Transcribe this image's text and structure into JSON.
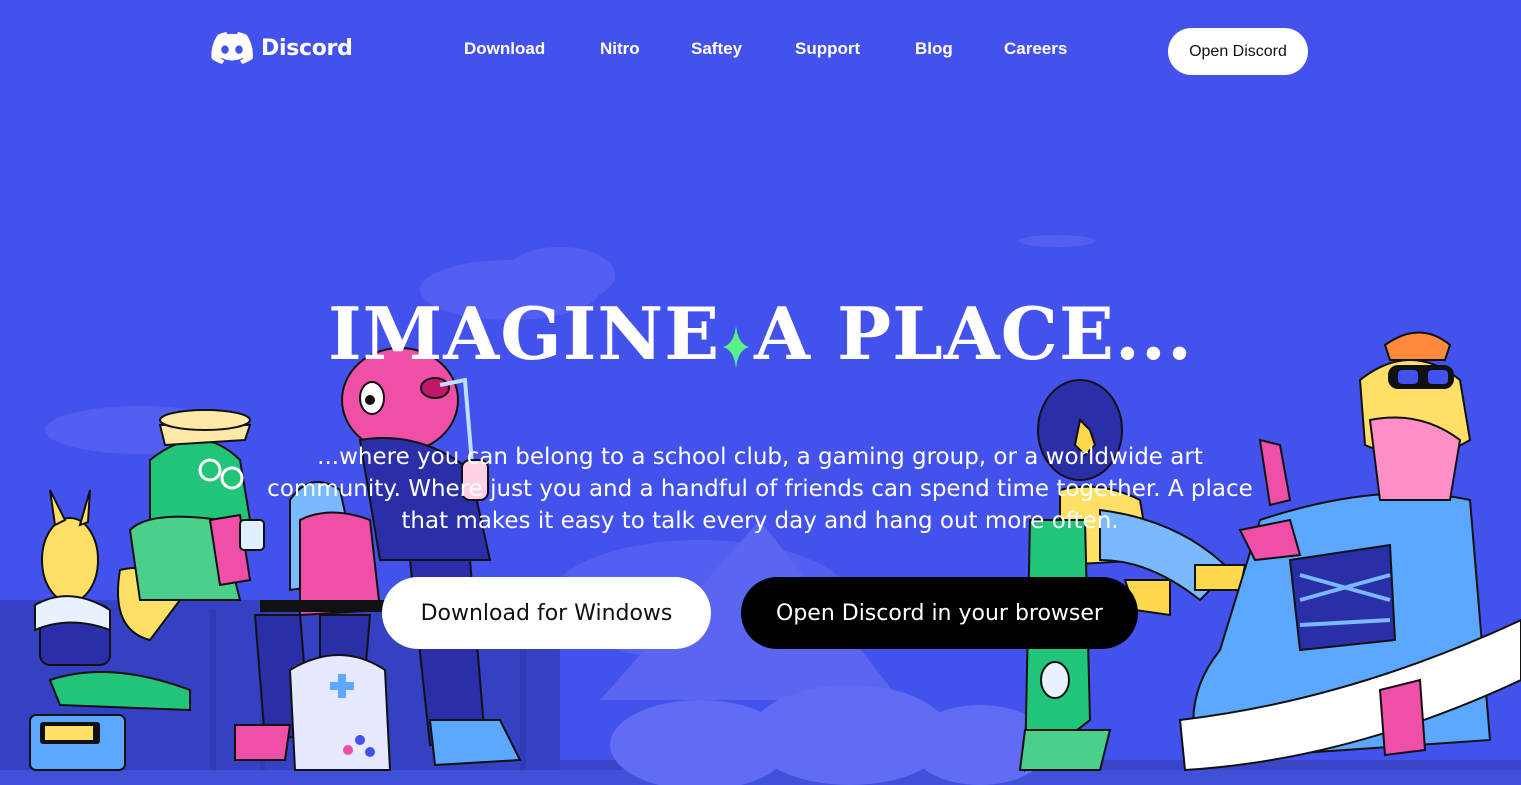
{
  "brand": {
    "name": "Discord"
  },
  "nav": {
    "items": [
      {
        "label": "Download"
      },
      {
        "label": "Nitro"
      },
      {
        "label": "Saftey"
      },
      {
        "label": "Support"
      },
      {
        "label": "Blog"
      },
      {
        "label": "Careers"
      }
    ],
    "open_button": "Open Discord"
  },
  "hero": {
    "title_left": "IMAGINE",
    "title_right": "A PLACE...",
    "subtitle": "...where you can belong to a school club, a gaming group, or a worldwide art community. Where just you and a handful of friends can spend time together. A place that makes it easy to talk every day and hang out more often.",
    "download_button": "Download for Windows",
    "browser_button": "Open Discord in your browser"
  },
  "colors": {
    "background": "#4352ec",
    "blurple_dark": "#3a45c8",
    "accent_green": "#22c47a",
    "accent_pink": "#ef4fa6",
    "accent_yellow": "#ffd84d",
    "sparkle": "#58f287"
  },
  "icons": [
    "discord-logo-icon",
    "sparkle-icon"
  ]
}
